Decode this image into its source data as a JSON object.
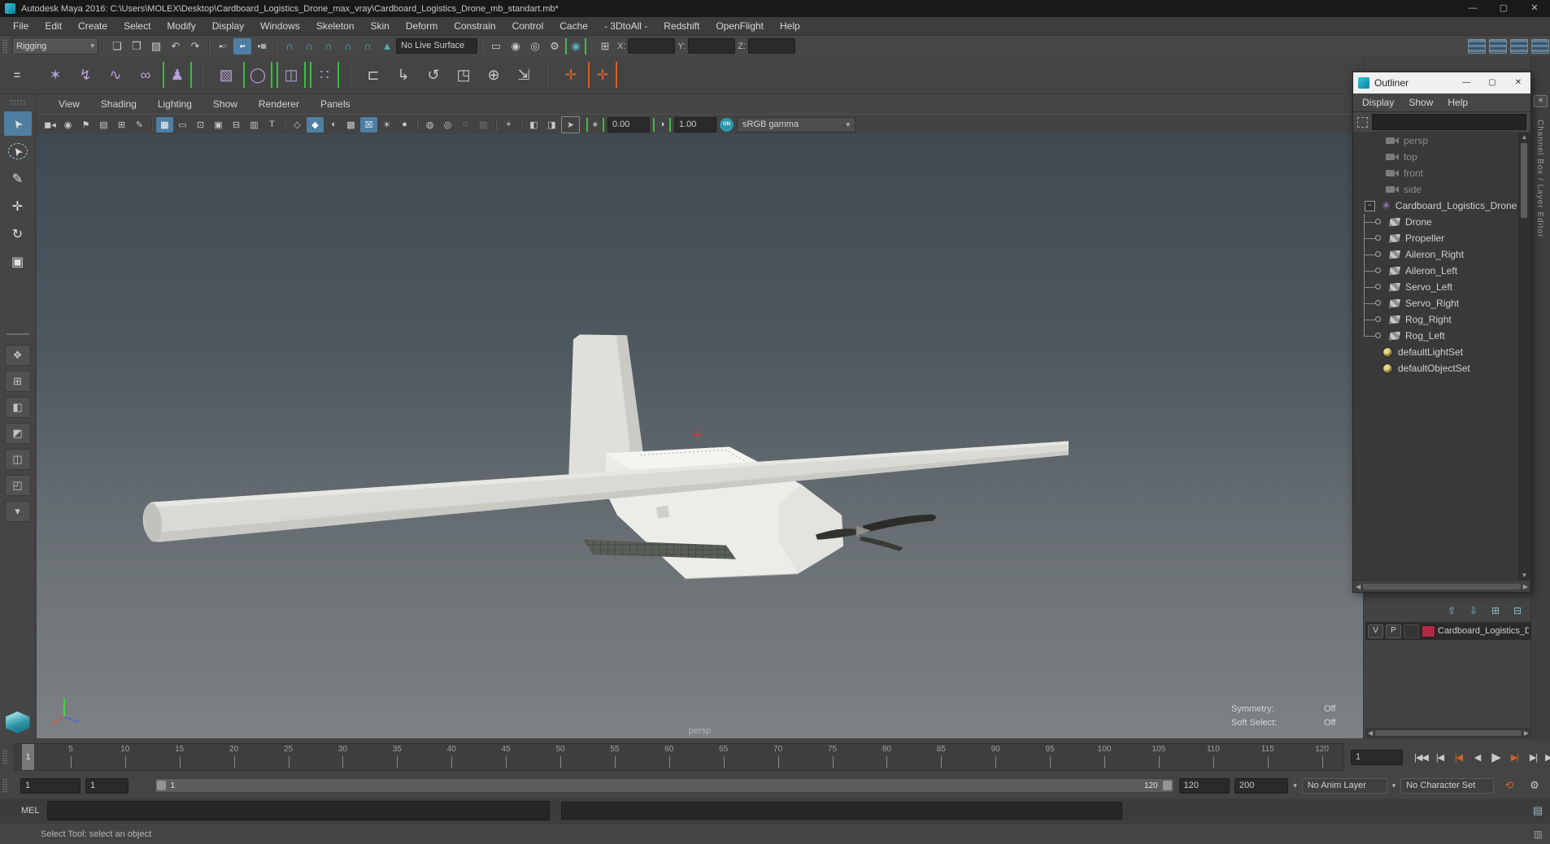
{
  "title_bar": {
    "title": "Autodesk Maya 2016: C:\\Users\\MOLEX\\Desktop\\Cardboard_Logistics_Drone_max_vray\\Cardboard_Logistics_Drone_mb_standart.mb*",
    "minimize": "—",
    "maximize": "▢",
    "close": "✕"
  },
  "menu_bar": {
    "items": [
      "File",
      "Edit",
      "Create",
      "Select",
      "Modify",
      "Display",
      "Windows",
      "Skeleton",
      "Skin",
      "Deform",
      "Constrain",
      "Control",
      "Cache",
      "- 3DtoAll -",
      "Redshift",
      "OpenFlight",
      "Help"
    ]
  },
  "status_line": {
    "menu_set": "Rigging",
    "file_icons": [
      {
        "name": "new-scene-icon",
        "glyph": "❏"
      },
      {
        "name": "open-scene-icon",
        "glyph": "❒"
      },
      {
        "name": "save-scene-icon",
        "glyph": "▧"
      },
      {
        "name": "undo-icon",
        "glyph": "↶"
      },
      {
        "name": "redo-icon",
        "glyph": "↷"
      }
    ],
    "mask_icons": [
      {
        "name": "select-by-hierarchy-icon",
        "glyph": "▸▱"
      },
      {
        "name": "select-by-object-icon",
        "glyph": "▸▪",
        "active": true
      },
      {
        "name": "select-by-component-icon",
        "glyph": "▸▦"
      }
    ],
    "snap_icons": [
      {
        "name": "snap-to-grid-icon",
        "glyph": "∩",
        "teal": true
      },
      {
        "name": "snap-to-curve-icon",
        "glyph": "∩",
        "teal": true
      },
      {
        "name": "snap-to-point-icon",
        "glyph": "∩",
        "teal": true
      },
      {
        "name": "snap-to-projected-center-icon",
        "glyph": "∩",
        "teal": true
      },
      {
        "name": "snap-to-view-plane-icon",
        "glyph": "∩",
        "teal": true
      },
      {
        "name": "make-live-icon",
        "glyph": "▲",
        "teal": true
      }
    ],
    "live_surface": "No Live Surface",
    "render_icons": [
      {
        "name": "open-render-view-icon",
        "glyph": "▭"
      },
      {
        "name": "render-current-frame-icon",
        "glyph": "◉"
      },
      {
        "name": "ipr-render-icon",
        "glyph": "◎"
      },
      {
        "name": "render-settings-icon",
        "glyph": "⚙"
      },
      {
        "name": "render-setup-icon",
        "glyph": "◉",
        "bracket": "green",
        "teal": true
      }
    ],
    "input_icon": {
      "name": "input-field-mode-icon",
      "glyph": "⊞"
    },
    "x_label": "X:",
    "y_label": "Y:",
    "z_label": "Z:",
    "sidebar_icons": [
      {
        "name": "modeling-toolkit-toggle-icon",
        "style": "panel"
      },
      {
        "name": "attribute-editor-toggle-icon",
        "style": "panel"
      },
      {
        "name": "tool-settings-toggle-icon",
        "style": "panel"
      },
      {
        "name": "channel-box-toggle-icon",
        "style": "panel"
      }
    ]
  },
  "shelf": {
    "tab_button": "=",
    "items": [
      {
        "name": "create-joint-icon",
        "glyph": "✶",
        "style": "purple"
      },
      {
        "name": "ik-handle-icon",
        "glyph": "↯",
        "style": "purple"
      },
      {
        "name": "ik-spline-handle-icon",
        "glyph": "∿",
        "style": "purple"
      },
      {
        "name": "quick-rig-icon",
        "glyph": "∞",
        "style": "purple"
      },
      {
        "name": "humanik-icon",
        "glyph": "♟",
        "style": "purple",
        "bracket": "green"
      },
      {
        "sep": true
      },
      {
        "name": "bind-skin-icon",
        "glyph": "▧",
        "style": "purple"
      },
      {
        "name": "interactive-bind-icon",
        "glyph": "◯",
        "style": "purple",
        "bracket": "green"
      },
      {
        "name": "geodesic-voxel-bind-icon",
        "glyph": "◫",
        "style": "purple",
        "bracket": "green"
      },
      {
        "name": "detach-skin-icon",
        "glyph": "∷",
        "style": "purple",
        "bracket": "green"
      },
      {
        "sep": true
      },
      {
        "name": "parent-constraint-icon",
        "glyph": "⊏",
        "style": "gray"
      },
      {
        "name": "point-constraint-icon",
        "glyph": "↳",
        "style": "gray"
      },
      {
        "name": "orient-constraint-icon",
        "glyph": "↺",
        "style": "gray"
      },
      {
        "name": "aim-constraint-icon",
        "glyph": "◳",
        "style": "gray"
      },
      {
        "name": "pole-vector-constraint-icon",
        "glyph": "⊕",
        "style": "gray"
      },
      {
        "name": "scale-constraint-icon",
        "glyph": "⇲",
        "style": "gray"
      },
      {
        "sep": true
      },
      {
        "name": "control-curve-icon",
        "glyph": "✛",
        "style": "orange"
      },
      {
        "name": "control-group-icon",
        "glyph": "✛",
        "style": "orange",
        "bracket": "orange"
      }
    ]
  },
  "toolbox": {
    "tools": [
      {
        "name": "select-tool",
        "glyph": "➤",
        "active": true
      },
      {
        "name": "lasso-tool",
        "glyph": "➤"
      },
      {
        "name": "paint-select-tool",
        "glyph": "✎"
      },
      {
        "name": "move-tool",
        "glyph": "✛",
        "teal": true
      },
      {
        "name": "rotate-tool",
        "glyph": "↻",
        "teal": true
      },
      {
        "name": "scale-tool",
        "glyph": "▣",
        "teal": true
      }
    ],
    "layouts": [
      {
        "name": "single-pane-layout-button",
        "glyph": "❖"
      },
      {
        "name": "four-pane-layout-button",
        "glyph": "⊞"
      },
      {
        "name": "persp-outliner-layout-button",
        "glyph": "◧"
      },
      {
        "name": "persp-graph-layout-button",
        "glyph": "◩"
      },
      {
        "name": "hypershade-layout-button",
        "glyph": "◫"
      },
      {
        "name": "persp-uv-layout-button",
        "glyph": "◰"
      },
      {
        "name": "layout-more-button",
        "glyph": "▾"
      }
    ]
  },
  "viewport": {
    "menus": [
      "View",
      "Shading",
      "Lighting",
      "Show",
      "Renderer",
      "Panels"
    ],
    "toolbar_icons": [
      {
        "name": "select-camera-icon",
        "glyph": "◼◂"
      },
      {
        "name": "camera-attributes-icon",
        "glyph": "◉"
      },
      {
        "name": "bookmark-icon",
        "glyph": "⚑"
      },
      {
        "name": "image-plane-icon",
        "glyph": "▤"
      },
      {
        "name": "2d-pan-zoom-icon",
        "glyph": "⊞"
      },
      {
        "name": "grease-pencil-icon",
        "glyph": "✎"
      },
      {
        "sep": true
      },
      {
        "name": "grid-toggle-icon",
        "glyph": "▦",
        "active": true
      },
      {
        "name": "film-gate-icon",
        "glyph": "▭"
      },
      {
        "name": "resolution-gate-icon",
        "glyph": "⊡"
      },
      {
        "name": "gate-mask-icon",
        "glyph": "▣"
      },
      {
        "name": "field-chart-icon",
        "glyph": "⊟"
      },
      {
        "name": "safe-action-icon",
        "glyph": "▥"
      },
      {
        "name": "safe-title-icon",
        "glyph": "T"
      },
      {
        "sep": true
      },
      {
        "name": "wireframe-icon",
        "glyph": "◇"
      },
      {
        "name": "smooth-shade-icon",
        "glyph": "◆",
        "active": true
      },
      {
        "name": "flat-shade-icon",
        "glyph": "◖"
      },
      {
        "name": "textured-icon",
        "glyph": "▩"
      },
      {
        "name": "wireframe-on-shaded-icon",
        "glyph": "☒",
        "active": true
      },
      {
        "name": "default-lighting-icon",
        "glyph": "☀"
      },
      {
        "name": "shadows-icon",
        "glyph": "●"
      },
      {
        "sep": true
      },
      {
        "name": "occlusion-icon",
        "glyph": "◍"
      },
      {
        "name": "motion-blur-icon",
        "glyph": "◎"
      },
      {
        "name": "multisample-icon",
        "glyph": "◌"
      },
      {
        "name": "render-override-icon",
        "glyph": "▨",
        "disabled": true
      },
      {
        "sep": true
      },
      {
        "name": "isolate-select-icon",
        "glyph": "⌖"
      },
      {
        "sep": true
      },
      {
        "name": "pane-layout-a-icon",
        "glyph": "◧"
      },
      {
        "name": "pane-layout-b-icon",
        "glyph": "◨"
      },
      {
        "name": "selection-highlight-icon",
        "glyph": "➤",
        "boxed": true
      }
    ],
    "exposure_icon": {
      "name": "exposure-icon",
      "glyph": "✴",
      "bracket": "green"
    },
    "exposure_value": "0.00",
    "contrast_icon": {
      "name": "contrast-icon",
      "glyph": "◑",
      "bracket": "green"
    },
    "contrast_value": "1.00",
    "gamma_toggle": "ON",
    "color_transform": "sRGB gamma",
    "camera_label": "persp",
    "symmetry_label": "Symmetry:",
    "symmetry_value": "Off",
    "soft_select_label": "Soft Select:",
    "soft_select_value": "Off"
  },
  "outliner": {
    "window_title": "Outliner",
    "minimize": "—",
    "maximize": "▢",
    "close": "✕",
    "menus": [
      "Display",
      "Show",
      "Help"
    ],
    "items": [
      {
        "label": "persp",
        "type": "camera",
        "muted": true
      },
      {
        "label": "top",
        "type": "camera",
        "muted": true
      },
      {
        "label": "front",
        "type": "camera",
        "muted": true
      },
      {
        "label": "side",
        "type": "camera",
        "muted": true
      },
      {
        "label": "Cardboard_Logistics_Drone",
        "type": "group"
      },
      {
        "label": "Drone",
        "type": "mesh",
        "child": true
      },
      {
        "label": "Propeller",
        "type": "mesh",
        "child": true
      },
      {
        "label": "Aileron_Right",
        "type": "mesh",
        "child": true
      },
      {
        "label": "Aileron_Left",
        "type": "mesh",
        "child": true
      },
      {
        "label": "Servo_Left",
        "type": "mesh",
        "child": true
      },
      {
        "label": "Servo_Right",
        "type": "mesh",
        "child": true
      },
      {
        "label": "Rog_Right",
        "type": "mesh",
        "child": true
      },
      {
        "label": "Rog_Left",
        "type": "mesh",
        "child": true,
        "last": true
      },
      {
        "label": "defaultLightSet",
        "type": "set"
      },
      {
        "label": "defaultObjectSet",
        "type": "set"
      }
    ]
  },
  "channel_box": {
    "tab_title": "Channel Box / Layer Editor",
    "close": "✕",
    "layer_icons": [
      {
        "name": "move-layer-up-icon",
        "glyph": "⇧"
      },
      {
        "name": "move-layer-down-icon",
        "glyph": "⇩"
      },
      {
        "name": "create-empty-layer-icon",
        "glyph": "⊞"
      },
      {
        "name": "create-layer-from-selected-icon",
        "glyph": "⊟"
      }
    ],
    "visibility_label": "V",
    "playback_label": "P",
    "layer_color": "#b32747",
    "layer_name": "Cardboard_Logistics_D"
  },
  "timeline": {
    "marker": "1",
    "ticks": [
      "5",
      "10",
      "15",
      "20",
      "25",
      "30",
      "35",
      "40",
      "45",
      "50",
      "55",
      "60",
      "65",
      "70",
      "75",
      "80",
      "85",
      "90",
      "95",
      "100",
      "105",
      "110",
      "115",
      "120"
    ],
    "current_frame": "1",
    "playback": [
      {
        "name": "go-to-start-button",
        "glyph": "|◀◀"
      },
      {
        "name": "step-back-frame-button",
        "glyph": "|◀"
      },
      {
        "name": "step-back-key-button",
        "glyph": "|◀",
        "accent": true
      },
      {
        "name": "play-backwards-button",
        "glyph": "◀"
      },
      {
        "name": "play-forwards-button",
        "glyph": "▶",
        "big": true
      },
      {
        "name": "step-forward-key-button",
        "glyph": "▶|",
        "accent": true
      },
      {
        "name": "step-forward-frame-button",
        "glyph": "▶|"
      },
      {
        "name": "go-to-end-button",
        "glyph": "▶▶|"
      }
    ]
  },
  "range": {
    "range_start": "1",
    "inner_start": "1",
    "bar_start": "1",
    "bar_end": "120",
    "range_end": "120",
    "playback_end": "200",
    "anim_layer": "No Anim Layer",
    "character_set": "No Character Set",
    "icons": [
      {
        "name": "auto-keyframe-icon",
        "glyph": "⟲",
        "accent": true
      },
      {
        "name": "animation-preferences-icon",
        "glyph": "⚙"
      }
    ]
  },
  "command_line": {
    "label": "MEL",
    "icon": {
      "name": "script-editor-icon",
      "glyph": "▤"
    }
  },
  "help_line": {
    "text": "Select Tool: select an object",
    "icon": {
      "name": "quick-help-icon",
      "glyph": "▥"
    }
  }
}
